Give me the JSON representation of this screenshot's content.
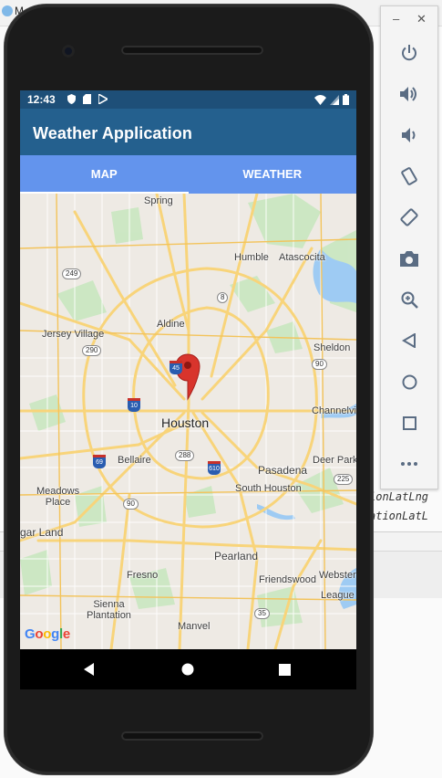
{
  "ide": {
    "title_fragment": "M",
    "code_right_1": "ionLatLng",
    "code_right_2": "ationLatL"
  },
  "statusbar": {
    "time": "12:43"
  },
  "app": {
    "title": "Weather Application"
  },
  "tabs": [
    {
      "label": "MAP",
      "active": true
    },
    {
      "label": "WEATHER",
      "active": false
    }
  ],
  "map": {
    "labels": {
      "spring": "Spring",
      "humble": "Humble",
      "atascocita": "Atascocita",
      "aldine": "Aldine",
      "jersey_village": "Jersey Village",
      "sheldon": "Sheldon",
      "channelview": "Channelview",
      "houston": "Houston",
      "bellaire": "Bellaire",
      "deer_park": "Deer Park",
      "pasadena": "Pasadena",
      "meadows_place": "Meadows\nPlace",
      "south_houston": "South Houston",
      "sugar_land": "gar Land",
      "pearland": "Pearland",
      "fresno": "Fresno",
      "friendswood": "Friendswood",
      "webster": "Webster",
      "league": "League",
      "sienna_plantation": "Sienna\nPlantation",
      "manvel": "Manvel"
    },
    "shields": {
      "r249": "249",
      "r8": "8",
      "r290": "290",
      "r45": "45",
      "r10": "10",
      "r90": "90",
      "r288": "288",
      "r69": "69",
      "r610": "610",
      "r225": "225",
      "alt90": "90",
      "r35": "35"
    },
    "attribution": "Google",
    "marker_color": "#d8342c"
  },
  "colors": {
    "status_bar": "#1e4f78",
    "app_bar": "#24608e",
    "tab_bar": "#6394ed",
    "road": "#f8d47a",
    "water": "#9ecbf3",
    "park": "#c7e8c0"
  }
}
